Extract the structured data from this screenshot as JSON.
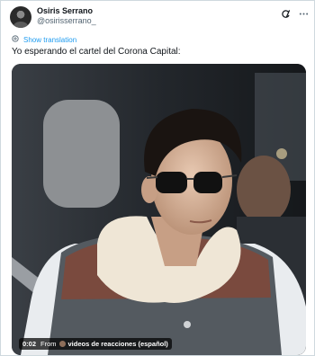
{
  "author": {
    "display_name": "Osiris Serrano",
    "handle": "@osirisserrano_"
  },
  "icons": {
    "header": [
      "grok-icon",
      "more-icon"
    ],
    "translate": "translate-icon"
  },
  "translate_link": "Show translation",
  "tweet_text": "Yo esperando el cartel del Corona Capital:",
  "video": {
    "time": "0:02",
    "from_label": "From",
    "source": "videos de reacciones (español)"
  },
  "colors": {
    "accent": "#1d9bf0",
    "text": "#0f1419",
    "muted": "#536471"
  }
}
